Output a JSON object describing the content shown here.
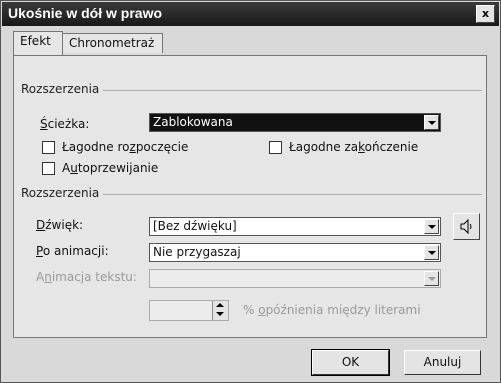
{
  "dialog": {
    "title": "Ukośnie w dół w prawo",
    "close_glyph": "x"
  },
  "tabs": [
    {
      "label": "Efekt",
      "active": true
    },
    {
      "label": "Chronometraż",
      "active": false
    }
  ],
  "group1": {
    "label": "Rozszerzenia",
    "path_label_pre": "",
    "path_label_u": "Ś",
    "path_label_post": "cieżka:",
    "path_value": "Zablokowana",
    "smooth_start": {
      "label_pre": "Łagodne ro",
      "label_u": "z",
      "label_post": "poczęcie",
      "checked": false
    },
    "smooth_end": {
      "label_pre": "Łagodne za",
      "label_u": "k",
      "label_post": "ończenie",
      "checked": false
    },
    "autoreverse": {
      "label_pre": "A",
      "label_u": "u",
      "label_post": "toprzewijanie",
      "checked": false
    }
  },
  "group2": {
    "label": "Rozszerzenia",
    "sound_label_pre": "",
    "sound_label_u": "D",
    "sound_label_post": "źwięk:",
    "sound_value": "[Bez dźwięku]",
    "after_label_pre": "",
    "after_label_u": "P",
    "after_label_post": "o animacji:",
    "after_value": "Nie przygaszaj",
    "text_anim_label_pre": "A",
    "text_anim_label_u": "n",
    "text_anim_label_post": "imacja tekstu:",
    "text_anim_value": "",
    "delay_value": "",
    "delay_label_pre": "% ",
    "delay_label_u": "o",
    "delay_label_post": "późnienia między literami"
  },
  "buttons": {
    "ok": "OK",
    "cancel": "Anuluj"
  },
  "icons": {
    "sound": "speaker-icon",
    "close": "close-icon",
    "dropdown": "chevron-down-icon"
  }
}
